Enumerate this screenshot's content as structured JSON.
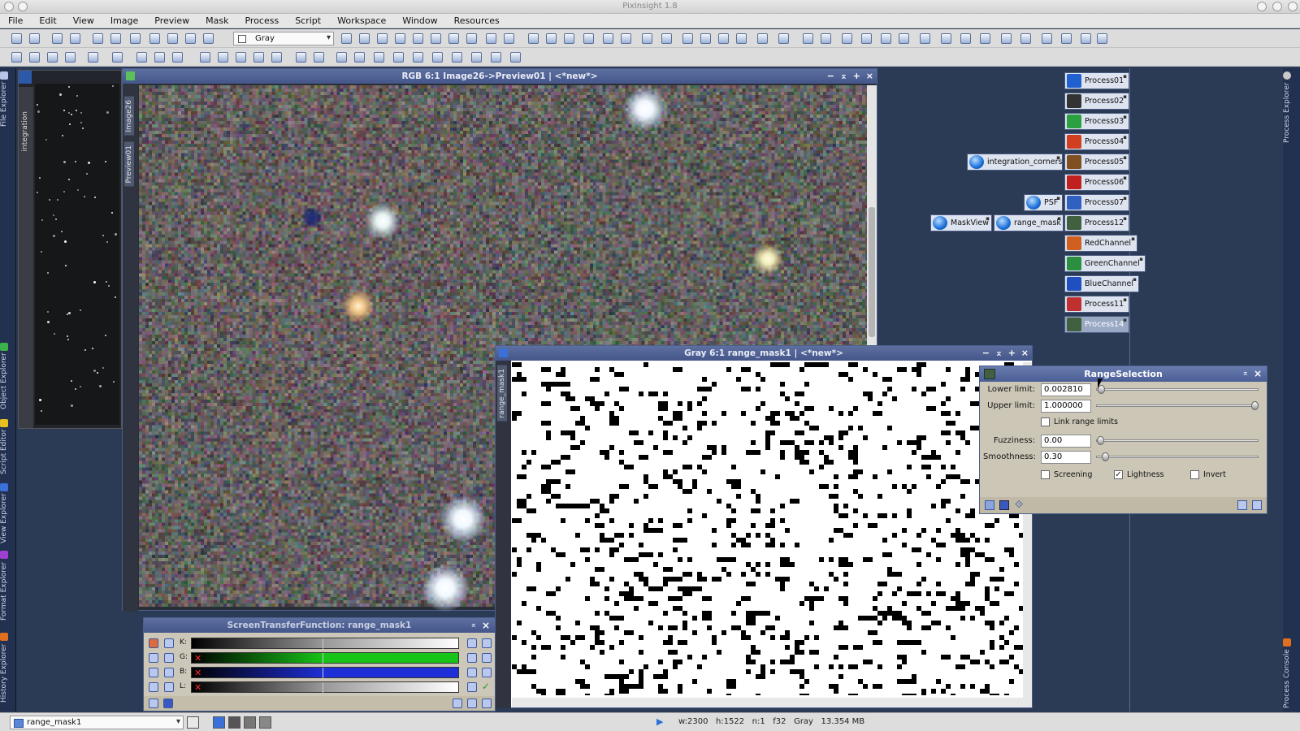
{
  "app": {
    "title": "PixInsight 1.8"
  },
  "menu": [
    "File",
    "Edit",
    "View",
    "Image",
    "Preview",
    "Mask",
    "Process",
    "Script",
    "Workspace",
    "Window",
    "Resources"
  ],
  "toolbar": {
    "color_space_combo": "Gray"
  },
  "left_tabs": [
    "File Explorer",
    "Object Explorer",
    "Script Editor",
    "View Explorer",
    "Format Explorer",
    "History Explorer"
  ],
  "right_tabs": [
    "Process Explorer",
    "Process Console"
  ],
  "thumbnail_panel": {
    "label": "integration"
  },
  "main_image_window": {
    "title": "RGB 6:1 Image26->Preview01 | <*new*>",
    "side_tabs": [
      "Image26",
      "Preview01"
    ]
  },
  "mask_window": {
    "title": "Gray 6:1 range_mask1 | <*new*>",
    "side_tab": "range_mask1"
  },
  "stf_panel": {
    "title": "ScreenTransferFunction: range_mask1",
    "channels": [
      "K:",
      "G:",
      "B:",
      "L:"
    ],
    "channel_colors": [
      "#9a9a9a",
      "#17c417",
      "#1e2fd8",
      "#9a9a9a"
    ]
  },
  "process_icons": [
    {
      "label": "Process01",
      "color": "#2060d0"
    },
    {
      "label": "Process02",
      "color": "#333"
    },
    {
      "label": "Process03",
      "color": "#2aa040"
    },
    {
      "label": "Process04",
      "color": "#d04020"
    },
    {
      "label": "Process05",
      "color": "#805020"
    },
    {
      "label": "Process06",
      "color": "#c02020"
    },
    {
      "label": "Process07",
      "color": "#3060c0"
    },
    {
      "label": "Process12",
      "color": "#406040"
    },
    {
      "label": "RedChannel",
      "color": "#d06020"
    },
    {
      "label": "GreenChannel",
      "color": "#2a9040"
    },
    {
      "label": "BlueChannel",
      "color": "#2050c0"
    },
    {
      "label": "Process11",
      "color": "#c03030"
    },
    {
      "label": "Process14",
      "color": "#406040"
    }
  ],
  "instance_icons": [
    {
      "label": "integration_corners"
    },
    {
      "label": "PSF"
    },
    {
      "label": "MaskView"
    },
    {
      "label": "range_mask"
    }
  ],
  "range_selection": {
    "title": "RangeSelection",
    "lower_limit_label": "Lower limit:",
    "lower_limit_value": "0.002810",
    "lower_limit_fraction": 0.00281,
    "upper_limit_label": "Upper limit:",
    "upper_limit_value": "1.000000",
    "upper_limit_fraction": 1.0,
    "link_label": "Link range limits",
    "link_checked": false,
    "fuzziness_label": "Fuzziness:",
    "fuzziness_value": "0.00",
    "fuzziness_fraction": 0.0,
    "smoothness_label": "Smoothness:",
    "smoothness_value": "0.30",
    "smoothness_fraction": 0.03,
    "screening_label": "Screening",
    "screening_checked": false,
    "lightness_label": "Lightness",
    "lightness_checked": true,
    "invert_label": "Invert",
    "invert_checked": false
  },
  "status_bar": {
    "view_selector": "range_mask1",
    "info": "w:2300   h:1522   n:1   f32   Gray   13.354 MB"
  }
}
